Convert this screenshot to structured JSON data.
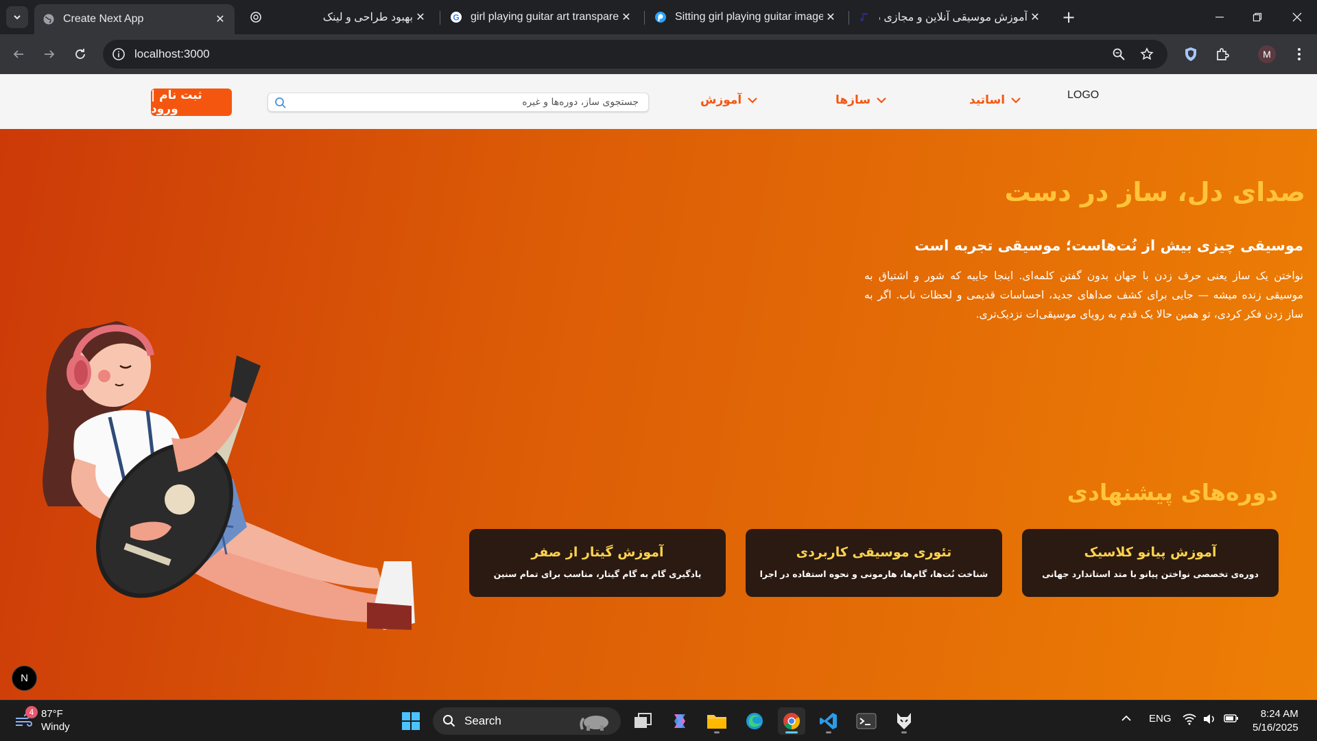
{
  "browser": {
    "tabs": [
      {
        "title": "Create Next App",
        "icon": "globe-icon",
        "active": true
      },
      {
        "title": "",
        "icon": "openai-icon",
        "active": false
      },
      {
        "title": "بهبود طراحی و لینک",
        "icon": "",
        "active": false
      },
      {
        "title": "girl playing guitar art transparent",
        "icon": "google-icon",
        "active": false
      },
      {
        "title": "Sitting girl playing guitar image",
        "icon": "picsart-icon",
        "active": false
      },
      {
        "title": "آموزش موسیقی آنلاین و مجازی در",
        "icon": "music-note-icon",
        "active": false
      }
    ],
    "url": "localhost:3000",
    "profile_initial": "M"
  },
  "header": {
    "cta": "ثبت نام | ورود",
    "search_placeholder": "جستجوی ساز، دوره‌ها و غیره",
    "nav": [
      "آموزش",
      "سازها",
      "اساتید"
    ],
    "logo": "LOGO"
  },
  "hero": {
    "title": "صدای دل، ساز در دست",
    "subtitle": "موسیقی چیزی بیش از نُت‌هاست؛ موسیقی تجربه است",
    "body": "نواختن یک ساز یعنی حرف زدن با جهان بدون گفتن کلمه‌ای. اینجا جاییه که شور و اشتیاق به موسیقی زنده میشه — جایی برای کشف صداهای جدید، احساسات قدیمی و لحظات ناب. اگر به ساز زدن فکر کردی، تو همین حالا یک قدم به رویای موسیقی‌ات نزدیک‌تری."
  },
  "recommended": {
    "title": "دوره‌های پیشنهادی",
    "cards": [
      {
        "title": "آموزش پیانو کلاسیک",
        "desc": "دوره‌ی تخصصی نواختن پیانو با متد استاندارد جهانی"
      },
      {
        "title": "تئوری موسیقی کاربردی",
        "desc": "شناخت نُت‌ها، گام‌ها، هارمونی و نحوه استفاده در اجرا"
      },
      {
        "title": "آموزش گیتار از صفر",
        "desc": "یادگیری گام به گام گیتار، مناسب برای تمام سنین"
      }
    ]
  },
  "next_badge": "N",
  "taskbar": {
    "weather_temp": "87°F",
    "weather_desc": "Windy",
    "weather_badge": "4",
    "search_label": "Search",
    "lang": "ENG",
    "time": "8:24 AM",
    "date": "5/16/2025"
  },
  "colors": {
    "accent": "#f5560f",
    "gold": "#ffc43a",
    "card": "#2a1a12"
  }
}
